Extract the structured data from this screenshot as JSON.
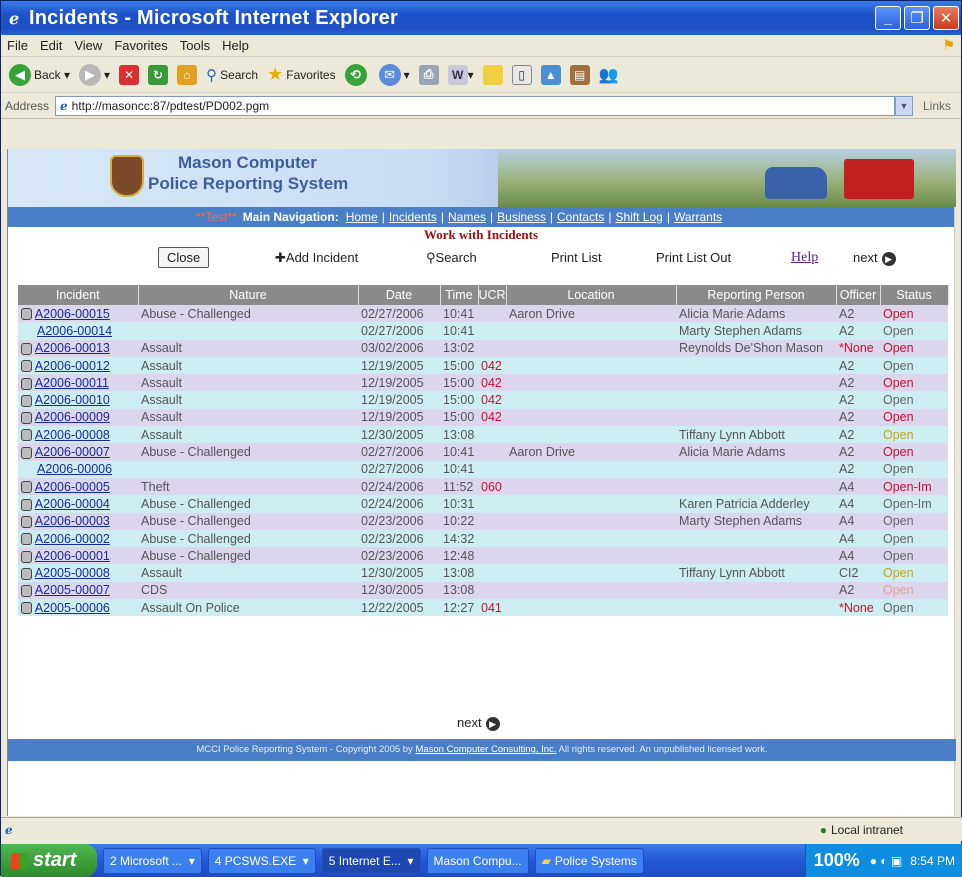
{
  "window": {
    "title": "Incidents - Microsoft Internet Explorer"
  },
  "menubar": [
    "File",
    "Edit",
    "View",
    "Favorites",
    "Tools",
    "Help"
  ],
  "toolbar": {
    "back": "Back",
    "search": "Search",
    "favorites": "Favorites"
  },
  "address": {
    "label": "Address",
    "url": "http://masoncc:87/pdtest/PD002.pgm",
    "links": "Links"
  },
  "banner": {
    "line1": "Mason Computer",
    "line2": "Police Reporting System"
  },
  "nav": {
    "test": "**Test**",
    "label": "Main Navigation:",
    "links": [
      "Home",
      "Incidents",
      "Names",
      "Business",
      "Contacts",
      "Shift Log",
      "Warrants"
    ]
  },
  "page": {
    "title": "Work with Incidents"
  },
  "actions": {
    "close": "Close",
    "add": "Add Incident",
    "search": "Search",
    "print_list": "Print List",
    "print_list_out": "Print List Out",
    "help": "Help",
    "next": "next"
  },
  "table": {
    "headers": [
      "Incident",
      "Nature",
      "Date",
      "Time",
      "UCR",
      "Location",
      "Reporting Person",
      "Officer",
      "Status"
    ],
    "rows": [
      {
        "icon": true,
        "incident": "A2006-00015",
        "nature": "Abuse - Challenged",
        "date": "02/27/2006",
        "time": "10:41",
        "ucr": "",
        "location": "Aaron Drive",
        "person": "Alicia Marie Adams",
        "officer": "A2",
        "status": "Open",
        "status_color": "#c8102e"
      },
      {
        "icon": false,
        "incident": "A2006-00014",
        "nature": "",
        "date": "02/27/2006",
        "time": "10:41",
        "ucr": "",
        "location": "",
        "person": "Marty Stephen Adams",
        "officer": "A2",
        "status": "Open",
        "status_color": "#666666"
      },
      {
        "icon": true,
        "incident": "A2006-00013",
        "nature": "Assault",
        "date": "03/02/2006",
        "time": "13:02",
        "ucr": "",
        "location": "",
        "person": "Reynolds De'Shon Mason",
        "officer": "*None",
        "status": "Open",
        "status_color": "#c8102e"
      },
      {
        "icon": true,
        "incident": "A2006-00012",
        "nature": "Assault",
        "date": "12/19/2005",
        "time": "15:00",
        "ucr": "042",
        "location": "",
        "person": "",
        "officer": "A2",
        "status": "Open",
        "status_color": "#666666"
      },
      {
        "icon": true,
        "incident": "A2006-00011",
        "nature": "Assault",
        "date": "12/19/2005",
        "time": "15:00",
        "ucr": "042",
        "location": "",
        "person": "",
        "officer": "A2",
        "status": "Open",
        "status_color": "#c8102e"
      },
      {
        "icon": true,
        "incident": "A2006-00010",
        "nature": "Assault",
        "date": "12/19/2005",
        "time": "15:00",
        "ucr": "042",
        "location": "",
        "person": "",
        "officer": "A2",
        "status": "Open",
        "status_color": "#666666"
      },
      {
        "icon": true,
        "incident": "A2006-00009",
        "nature": "Assault",
        "date": "12/19/2005",
        "time": "15:00",
        "ucr": "042",
        "location": "",
        "person": "",
        "officer": "A2",
        "status": "Open",
        "status_color": "#c8102e"
      },
      {
        "icon": true,
        "incident": "A2006-00008",
        "nature": "Assault",
        "date": "12/30/2005",
        "time": "13:08",
        "ucr": "",
        "location": "",
        "person": "Tiffany Lynn Abbott",
        "officer": "A2",
        "status": "Open",
        "status_color": "#c8a020"
      },
      {
        "icon": true,
        "incident": "A2006-00007",
        "nature": "Abuse - Challenged",
        "date": "02/27/2006",
        "time": "10:41",
        "ucr": "",
        "location": "Aaron Drive",
        "person": "Alicia Marie Adams",
        "officer": "A2",
        "status": "Open",
        "status_color": "#c8102e"
      },
      {
        "icon": false,
        "incident": "A2006-00006",
        "nature": "",
        "date": "02/27/2006",
        "time": "10:41",
        "ucr": "",
        "location": "",
        "person": "",
        "officer": "A2",
        "status": "Open",
        "status_color": "#666666"
      },
      {
        "icon": true,
        "incident": "A2006-00005",
        "nature": "Theft",
        "date": "02/24/2006",
        "time": "11:52",
        "ucr": "060",
        "location": "",
        "person": "",
        "officer": "A4",
        "status": "Open-Im",
        "status_color": "#c8102e"
      },
      {
        "icon": true,
        "incident": "A2006-00004",
        "nature": "Abuse - Challenged",
        "date": "02/24/2006",
        "time": "10:31",
        "ucr": "",
        "location": "",
        "person": "Karen Patricia Adderley",
        "officer": "A4",
        "status": "Open-Im",
        "status_color": "#666666"
      },
      {
        "icon": true,
        "incident": "A2006-00003",
        "nature": "Abuse - Challenged",
        "date": "02/23/2006",
        "time": "10:22",
        "ucr": "",
        "location": "",
        "person": "Marty Stephen Adams",
        "officer": "A4",
        "status": "Open",
        "status_color": "#666666"
      },
      {
        "icon": true,
        "incident": "A2006-00002",
        "nature": "Abuse - Challenged",
        "date": "02/23/2006",
        "time": "14:32",
        "ucr": "",
        "location": "",
        "person": "",
        "officer": "A4",
        "status": "Open",
        "status_color": "#666666"
      },
      {
        "icon": true,
        "incident": "A2006-00001",
        "nature": "Abuse - Challenged",
        "date": "02/23/2006",
        "time": "12:48",
        "ucr": "",
        "location": "",
        "person": "",
        "officer": "A4",
        "status": "Open",
        "status_color": "#666666"
      },
      {
        "icon": true,
        "incident": "A2005-00008",
        "nature": "Assault",
        "date": "12/30/2005",
        "time": "13:08",
        "ucr": "",
        "location": "",
        "person": "Tiffany Lynn Abbott",
        "officer": "CI2",
        "status": "Open",
        "status_color": "#c8a020"
      },
      {
        "icon": true,
        "incident": "A2005-00007",
        "nature": "CDS",
        "date": "12/30/2005",
        "time": "13:08",
        "ucr": "",
        "location": "",
        "person": "",
        "officer": "A2",
        "status": "Open",
        "status_color": "#e0a090"
      },
      {
        "icon": true,
        "incident": "A2005-00006",
        "nature": "Assault On Police",
        "date": "12/22/2005",
        "time": "12:27",
        "ucr": "041",
        "location": "",
        "person": "",
        "officer": "*None",
        "status": "Open",
        "status_color": "#666666"
      }
    ]
  },
  "footer": {
    "prefix": "MCCI Police Reporting System - Copyright 2005 by ",
    "link": "Mason Computer Consulting, Inc.",
    "suffix": " All rights reserved. An unpublished licensed work."
  },
  "statusbar": {
    "zone": "Local intranet"
  },
  "taskbar": {
    "start": "start",
    "tasks": [
      "2 Microsoft ...",
      "4 PCSWS.EXE",
      "5 Internet E...",
      "Mason Compu...",
      "Police Systems"
    ],
    "zoom": "100%",
    "clock": "8:54 PM"
  }
}
